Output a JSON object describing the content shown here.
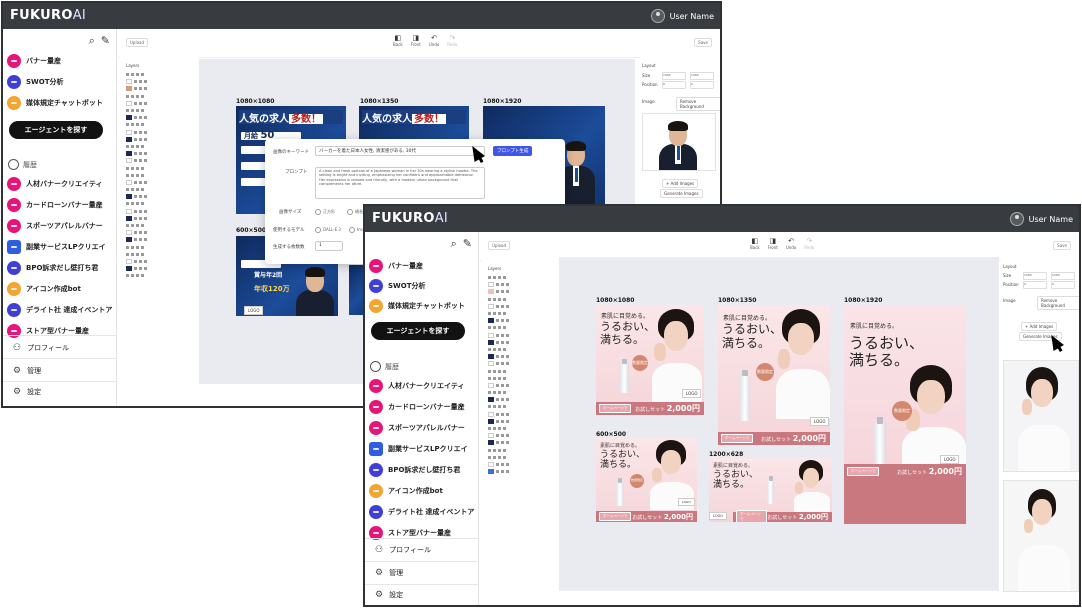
{
  "app": {
    "brand": "FUKURO",
    "brand_suffix": "AI",
    "user_name": "User Name"
  },
  "sidebar": {
    "agents": [
      {
        "label": "バナー量産",
        "color": "#e6157a",
        "icon": "banner-icon"
      },
      {
        "label": "SWOT分析",
        "color": "#3f3fd8",
        "icon": "analysis-icon"
      },
      {
        "label": "媒体規定チャットボット",
        "color": "#f2a531",
        "icon": "chat-icon"
      }
    ],
    "agent_button": "エージェントを探す",
    "history_title": "履歴",
    "history": [
      {
        "label": "人材バナークリエイティ",
        "color": "#e6157a"
      },
      {
        "label": "カードローンバナー量産",
        "color": "#e6157a"
      },
      {
        "label": "スポーツアパレルバナー",
        "color": "#e6157a"
      },
      {
        "label": "副業サービスLPクリエイ",
        "color": "#2f5de0"
      },
      {
        "label": "BPO訴求だし壁打ち君",
        "color": "#3f3fd8"
      },
      {
        "label": "アイコン作成bot",
        "color": "#f2a531"
      },
      {
        "label": "デライト社 達成イベントア",
        "color": "#3f3fd8"
      },
      {
        "label": "ストア型バナー量産",
        "color": "#e6157a"
      }
    ],
    "footer": [
      {
        "label": "プロフィール",
        "icon": "person-icon"
      },
      {
        "label": "管理",
        "icon": "gear-icon"
      },
      {
        "label": "設定",
        "icon": "settings-icon"
      }
    ]
  },
  "toolbar": {
    "left": "Upload",
    "right": "Save",
    "actions": [
      {
        "label": "Back",
        "icon": "back-icon"
      },
      {
        "label": "Front",
        "icon": "front-icon"
      },
      {
        "label": "Undo",
        "icon": "undo-icon"
      },
      {
        "label": "Redo",
        "icon": "redo-icon"
      }
    ]
  },
  "layers": {
    "title": "Layers"
  },
  "properties": {
    "layout_title": "Layout",
    "size_label": "Size",
    "position_label": "Position",
    "size_values": [
      "1080",
      "1080"
    ],
    "position_values": [
      "0",
      "0"
    ],
    "image_label": "Image",
    "remove_bg": "Remove Background",
    "add_images": "+ Add Images",
    "generate_images": "Generate Images"
  },
  "win1": {
    "sizes": [
      "1080×1080",
      "1080×1350",
      "1080×1920",
      "600×500"
    ],
    "headline": "人気の求人",
    "headline_em": "多数！",
    "salary_line": "月給",
    "salary_value": "50",
    "navy_snippets": [
      "貯金",
      "貯金",
      "貯金"
    ],
    "bonus_line": "賞与年2回",
    "annual_income": "年収120万",
    "logo": "LOGO"
  },
  "dialog": {
    "keyword_label": "画像のキーワード",
    "keyword_value": "バーカーを着た日本人女性, 清潔感がある, 30代",
    "prompt_button": "プロンプト生成",
    "prompt_label": "プロンプト",
    "prompt_value": "A clean and fresh portrait of a Japanese woman in her 30s wearing a stylish hoodie. The setting is bright and inviting, emphasizing her confident and approachable demeanor. Her expression is relaxed and friendly, with a modern urban background that complements her attire.",
    "size_label": "画像サイズ",
    "size_options": [
      "正方形",
      "横長"
    ],
    "model_label": "使用するモデル",
    "model_options": [
      "DALL-E 3",
      "Imag"
    ],
    "count_label": "生成する枚数数",
    "count_value": "1"
  },
  "win2": {
    "sizes": [
      "1080×1080",
      "1080×1350",
      "1080×1920",
      "600×500",
      "1200×628"
    ],
    "headline_small": "素肌に目覚める。",
    "headline_big_1": "うるおい、",
    "headline_big_2": "満ちる。",
    "badge": "数量限定",
    "chip": "ホームページで",
    "price_prefix": "お試しセット",
    "price_value": "2,000円",
    "logo": "LOGO"
  }
}
